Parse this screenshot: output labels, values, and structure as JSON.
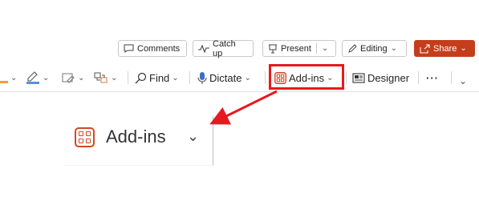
{
  "topbar": {
    "comments": {
      "label": "Comments",
      "icon": "comment-icon"
    },
    "catchup": {
      "label": "Catch up",
      "icon": "pulse-icon"
    },
    "present": {
      "label": "Present",
      "icon": "present-icon"
    },
    "editing": {
      "label": "Editing",
      "icon": "pencil-icon"
    },
    "share": {
      "label": "Share",
      "icon": "share-icon",
      "color": "#c43e1c"
    }
  },
  "ribbon": {
    "find": {
      "label": "Find",
      "icon": "search-icon"
    },
    "dictate": {
      "label": "Dictate",
      "icon": "microphone-icon"
    },
    "addins": {
      "label": "Add-ins",
      "icon": "add-ins-icon",
      "color": "#d24726"
    },
    "designer": {
      "label": "Designer",
      "icon": "designer-icon"
    },
    "more": {
      "label": "···"
    }
  },
  "callout": {
    "label": "Add-ins",
    "highlight_color": "#e8191e"
  }
}
